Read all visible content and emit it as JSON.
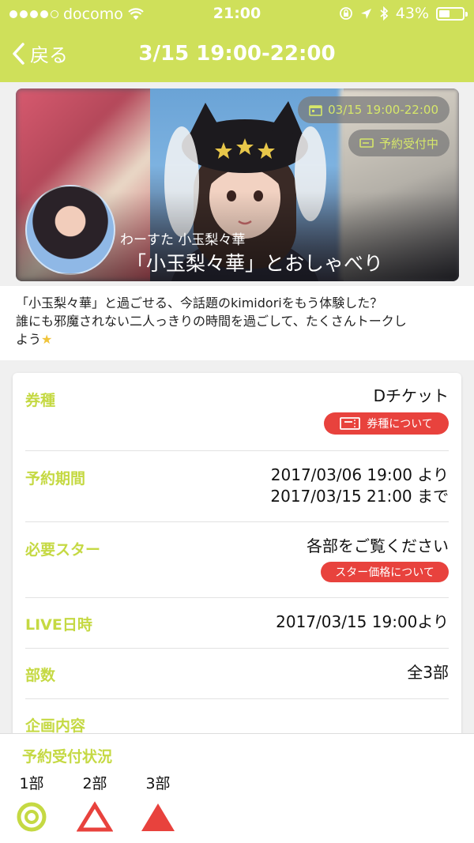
{
  "status_bar": {
    "carrier": "docomo",
    "time": "21:00",
    "battery": "43%",
    "battery_level": 0.43
  },
  "nav": {
    "back_label": "戻る",
    "title": "3/15 19:00-22:00"
  },
  "hero": {
    "date_pill": "03/15 19:00-22:00",
    "status_pill": "予約受付中",
    "artist": "わーすた 小玉梨々華",
    "event_title": "「小玉梨々華」とおしゃべり"
  },
  "description": {
    "line1": "「小玉梨々華」と過ごせる、今話題のkimidoriをもう体験した？",
    "line2": "誰にも邪魔されない二人っきりの時間を過ごして、たくさんトークし",
    "line3": "よう"
  },
  "details": {
    "ticket_type": {
      "label": "券種",
      "value": "Dチケット",
      "button": "券種について"
    },
    "reservation_period": {
      "label": "予約期間",
      "from": "2017/03/06 19:00 より",
      "to": "2017/03/15 21:00 まで"
    },
    "required_stars": {
      "label": "必要スター",
      "value": "各部をご覧ください",
      "button": "スター価格について"
    },
    "live_datetime": {
      "label": "LIVE日時",
      "value": "2017/03/15 19:00より"
    },
    "parts": {
      "label": "部数",
      "value": "全3部"
    },
    "plan": {
      "label": "企画内容"
    }
  },
  "reservation_status": {
    "heading": "予約受付状況",
    "parts": [
      {
        "label": "1部",
        "icon": "double-circle-icon",
        "color": "#c5d943"
      },
      {
        "label": "2部",
        "icon": "triangle-outline-icon",
        "color": "#e8423d"
      },
      {
        "label": "3部",
        "icon": "triangle-filled-icon",
        "color": "#e8423d"
      }
    ]
  },
  "colors": {
    "accent": "#cfe05a",
    "label": "#c5d943",
    "alert": "#e8423d"
  }
}
